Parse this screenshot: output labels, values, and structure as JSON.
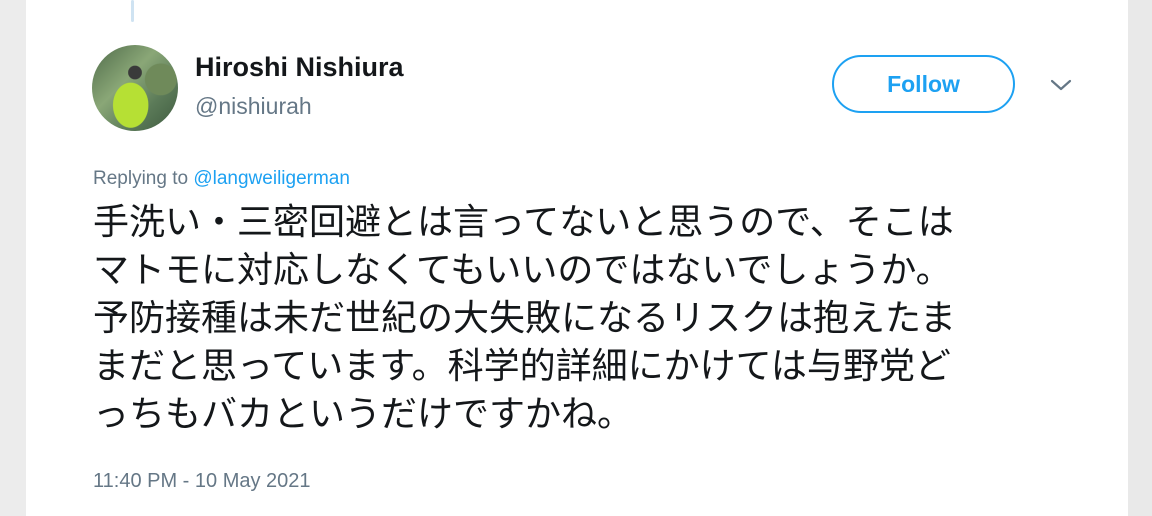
{
  "tweet": {
    "author": {
      "display_name": "Hiroshi Nishiura",
      "handle": "@nishiurah"
    },
    "follow_label": "Follow",
    "reply": {
      "prefix": "Replying to",
      "target": "@langweiligerman"
    },
    "text_lines": [
      "手洗い・三密回避とは言ってないと思うので、そこは",
      "マトモに対応しなくてもいいのではないでしょうか。",
      "予防接種は未だ世紀の大失敗になるリスクは抱えたま",
      "まだと思っています。科学的詳細にかけては与野党ど",
      "っちもバカというだけですかね。"
    ],
    "timestamp": "11:40 PM - 10 May 2021"
  },
  "icons": {
    "avatar": "profile-photo",
    "menu": "chevron-down-icon"
  },
  "colors": {
    "accent": "#1da1f2",
    "text": "#14171a",
    "secondary": "#657786"
  }
}
